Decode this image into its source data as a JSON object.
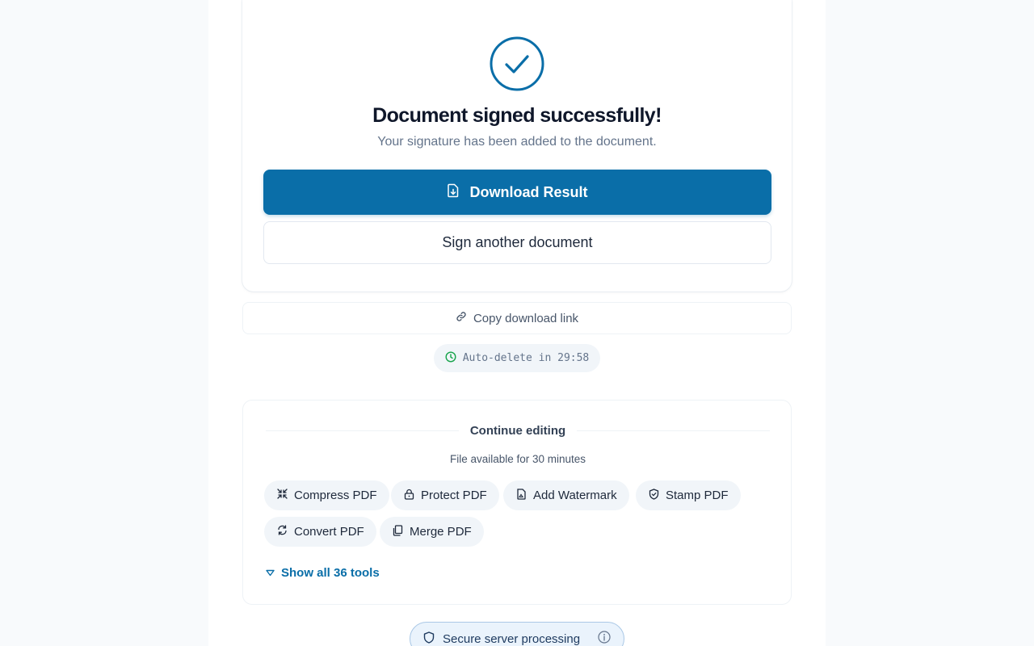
{
  "success": {
    "title": "Document signed successfully!",
    "subtitle": "Your signature has been added to the document.",
    "download_label": "Download Result",
    "sign_another_label": "Sign another document"
  },
  "copy_link_label": "Copy download link",
  "auto_delete_text": "Auto-delete in 29:58",
  "continue_editing": {
    "heading": "Continue editing",
    "availability": "File available for 30 minutes",
    "tools": [
      {
        "label": "Compress PDF",
        "icon": "compress-icon"
      },
      {
        "label": "Protect PDF",
        "icon": "lock-icon"
      },
      {
        "label": "Add Watermark",
        "icon": "watermark-icon"
      },
      {
        "label": "Stamp PDF",
        "icon": "stamp-icon"
      },
      {
        "label": "Convert PDF",
        "icon": "convert-icon"
      },
      {
        "label": "Merge PDF",
        "icon": "merge-icon"
      }
    ],
    "show_all_label": "Show all 36 tools"
  },
  "secure_badge_label": "Secure server processing",
  "colors": {
    "accent": "#0a6ea8",
    "timer_icon": "#16a34a"
  }
}
